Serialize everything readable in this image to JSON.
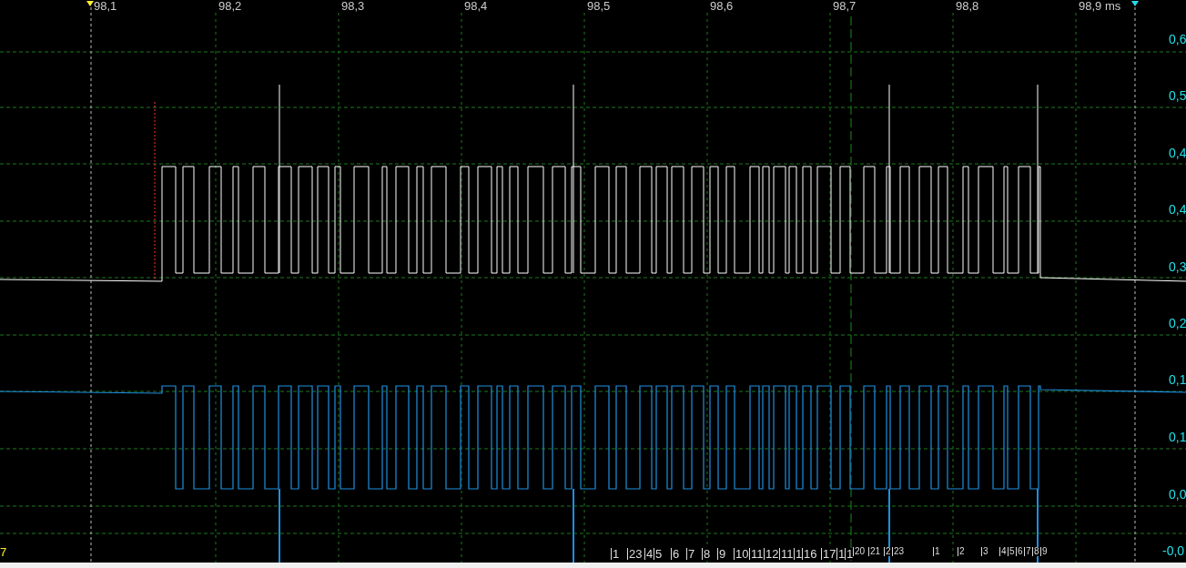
{
  "time_axis": {
    "ticks": [
      "98,1",
      "98,2",
      "98,3",
      "98,4",
      "98,5",
      "98,6",
      "98,7",
      "98,8",
      "98,9 ms"
    ]
  },
  "voltage_axis": {
    "ticks": [
      "0,6",
      "0,5",
      "0,4",
      "0,4",
      "0,3",
      "0,2",
      "0,1",
      "0,1",
      "0,0",
      "-0,0"
    ]
  },
  "channel_marker": "7",
  "decode_labels": [
    "1",
    "23",
    "4",
    "5",
    "6",
    "7",
    "8",
    "9",
    "10",
    "11",
    "12",
    "11",
    "1",
    "16",
    "17",
    "1",
    "1",
    "20",
    "21",
    "2",
    "23",
    "1",
    "2",
    "3",
    "4",
    "5",
    "6",
    "7",
    "8",
    "9"
  ]
}
